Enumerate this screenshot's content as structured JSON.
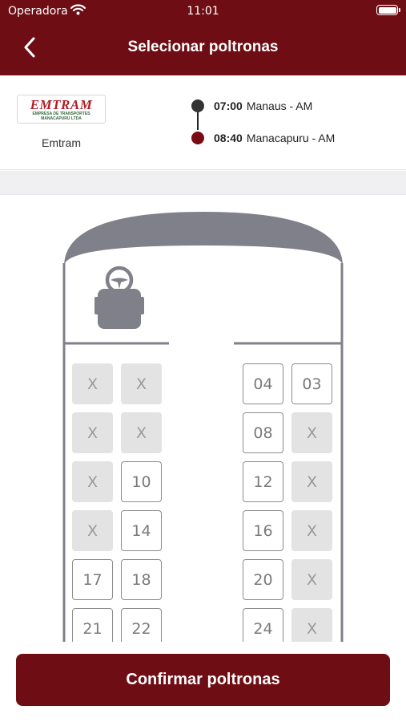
{
  "status_bar": {
    "carrier": "Operadora",
    "time": "11:01"
  },
  "nav": {
    "title": "Selecionar poltronas"
  },
  "company": {
    "logo_text": "EMTRAM",
    "logo_subtext": "EMPRESA DE TRANSPORTES MANACAPURU LTDA",
    "name": "Emtram"
  },
  "trip": {
    "origin": {
      "time": "07:00",
      "place": "Manaus - AM",
      "color": "#333333"
    },
    "destination": {
      "time": "08:40",
      "place": "Manacapuru - AM",
      "color": "#7a0a14"
    }
  },
  "seats": [
    {
      "label": "X",
      "status": "occupied"
    },
    {
      "label": "X",
      "status": "occupied"
    },
    {
      "label": "04",
      "status": "available"
    },
    {
      "label": "03",
      "status": "available"
    },
    {
      "label": "X",
      "status": "occupied"
    },
    {
      "label": "X",
      "status": "occupied"
    },
    {
      "label": "08",
      "status": "available"
    },
    {
      "label": "X",
      "status": "occupied"
    },
    {
      "label": "X",
      "status": "occupied"
    },
    {
      "label": "10",
      "status": "available"
    },
    {
      "label": "12",
      "status": "available"
    },
    {
      "label": "X",
      "status": "occupied"
    },
    {
      "label": "X",
      "status": "occupied"
    },
    {
      "label": "14",
      "status": "available"
    },
    {
      "label": "16",
      "status": "available"
    },
    {
      "label": "X",
      "status": "occupied"
    },
    {
      "label": "17",
      "status": "available"
    },
    {
      "label": "18",
      "status": "available"
    },
    {
      "label": "20",
      "status": "available"
    },
    {
      "label": "X",
      "status": "occupied"
    },
    {
      "label": "21",
      "status": "available"
    },
    {
      "label": "22",
      "status": "available"
    },
    {
      "label": "24",
      "status": "available"
    },
    {
      "label": "X",
      "status": "occupied"
    }
  ],
  "confirm": {
    "label": "Confirmar poltronas"
  },
  "colors": {
    "brand": "#6e0d14",
    "bus_outline": "#80808a"
  },
  "icons": {
    "back": "chevron-left-icon",
    "wifi": "wifi-icon",
    "battery": "battery-icon",
    "driver": "driver-seat-icon"
  }
}
